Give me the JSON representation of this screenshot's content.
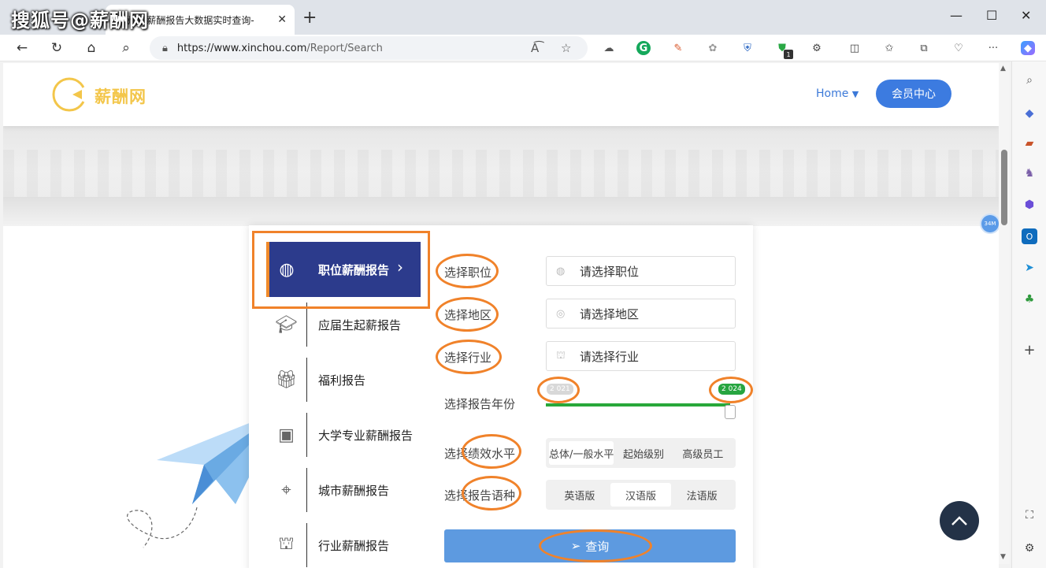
{
  "browser": {
    "tab_title": "薪酬网-薪酬报告大数据实时查询-",
    "tab_close": "✕",
    "new_tab": "+",
    "watermark": "搜狐号@薪酬网",
    "window_controls": {
      "minimize": "—",
      "maximize": "☐",
      "close": "✕"
    },
    "nav": {
      "back": "←",
      "reload": "↻",
      "home": "⌂",
      "search": "⌕"
    },
    "url_host": "https://www.xinchou.com",
    "url_path": "/Report/Search",
    "read_aloud_icon": "A͡",
    "favorite_icon": "☆",
    "extension_badge": "1",
    "more_menu": "···"
  },
  "site": {
    "logo_text": "薪酬网",
    "nav_home": "Home",
    "member_button": "会员中心",
    "floating_badge": "34M"
  },
  "menu": [
    {
      "label": "职位薪酬报告",
      "icon": "globe-icon",
      "active": true
    },
    {
      "label": "应届生起薪报告",
      "icon": "graduation-cap-icon",
      "active": false
    },
    {
      "label": "福利报告",
      "icon": "gift-icon",
      "active": false
    },
    {
      "label": "大学专业薪酬报告",
      "icon": "book-heart-icon",
      "active": false
    },
    {
      "label": "城市薪酬报告",
      "icon": "target-icon",
      "active": false
    },
    {
      "label": "行业薪酬报告",
      "icon": "factory-icon",
      "active": false
    }
  ],
  "form": {
    "position_label": "选择职位",
    "position_placeholder": "请选择职位",
    "region_label": "选择地区",
    "region_placeholder": "请选择地区",
    "industry_label": "选择行业",
    "industry_placeholder": "请选择行业",
    "year_label": "选择报告年份",
    "year_min": "2 021",
    "year_max": "2 024",
    "perf_label": "选择绩效水平",
    "perf_options": [
      "总体/一般水平",
      "起始级别",
      "高级员工"
    ],
    "perf_selected": "总体/一般水平",
    "lang_label": "选择报告语种",
    "lang_options": [
      "英语版",
      "汉语版",
      "法语版"
    ],
    "lang_selected": "汉语版",
    "query_button": "查询"
  },
  "colors": {
    "annotation": "#f0822a",
    "active_menu": "#2c3b8c",
    "brand_blue": "#3c7be0",
    "slider_green": "#28a83a",
    "logo_yellow": "#f3c64a"
  }
}
